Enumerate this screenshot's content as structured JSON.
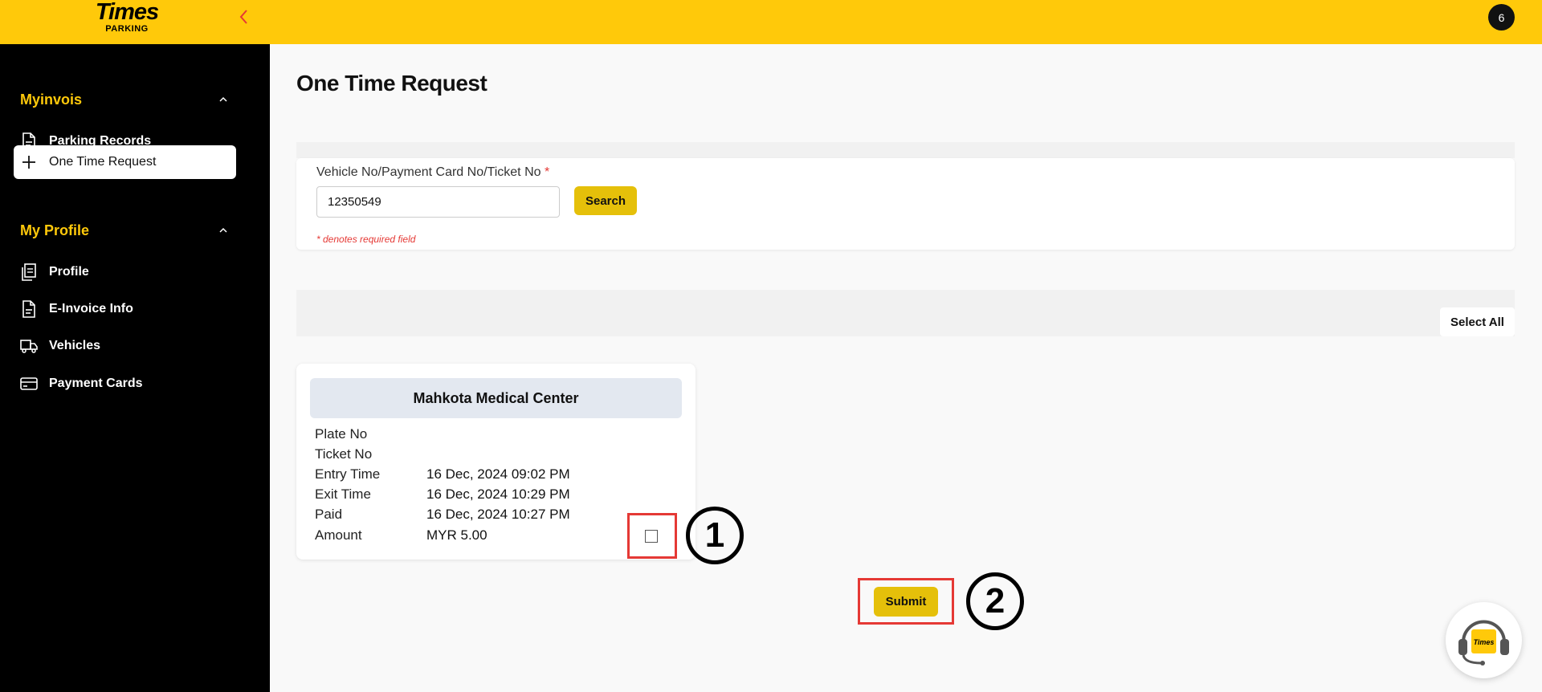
{
  "header": {
    "logo_main": "Times",
    "logo_sub": "PARKING",
    "notification_count": "6",
    "accent_color": "#ffc90a"
  },
  "sidebar": {
    "sections": [
      {
        "title": "Myinvois",
        "items": [
          {
            "label": "Parking Records",
            "icon": "document-icon"
          },
          {
            "label": "One Time Request",
            "icon": "plus-icon",
            "active": true
          }
        ]
      },
      {
        "title": "My Profile",
        "items": [
          {
            "label": "Profile",
            "icon": "clipboard-icon"
          },
          {
            "label": "E-Invoice Info",
            "icon": "document-icon"
          },
          {
            "label": "Vehicles",
            "icon": "truck-icon"
          },
          {
            "label": "Payment Cards",
            "icon": "credit-card-icon"
          }
        ]
      }
    ]
  },
  "main": {
    "title": "One Time Request",
    "search": {
      "label": "Vehicle No/Payment Card No/Ticket No",
      "required_marker": "*",
      "value": "12350549",
      "button": "Search",
      "required_note": "* denotes required field"
    },
    "select_all": "Select All",
    "record": {
      "location": "Mahkota Medical Center",
      "rows": [
        {
          "key": "Plate No",
          "value": ""
        },
        {
          "key": "Ticket No",
          "value": ""
        },
        {
          "key": "Entry Time",
          "value": "16 Dec, 2024 09:02 PM"
        },
        {
          "key": "Exit Time",
          "value": "16 Dec, 2024 10:29 PM"
        },
        {
          "key": "Paid",
          "value": "16 Dec, 2024 10:27 PM"
        },
        {
          "key": "Amount",
          "value": "MYR 5.00"
        }
      ],
      "checked": false
    },
    "submit": "Submit"
  },
  "annotations": {
    "step1": "1",
    "step2": "2"
  }
}
